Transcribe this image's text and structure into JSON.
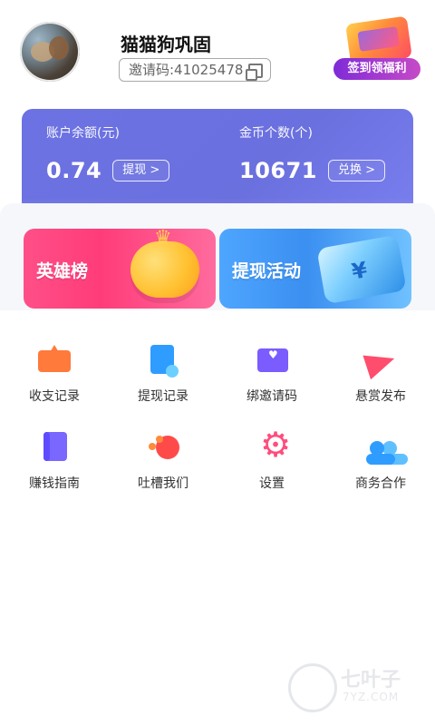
{
  "profile": {
    "username": "猫猫狗巩固",
    "invite_code": "邀请码:41025478"
  },
  "promo": {
    "checkin_label": "签到领福利"
  },
  "balance": {
    "account_title": "账户余额(元)",
    "account_value": "0.74",
    "withdraw_label": "提现 >",
    "coins_title": "金币个数(个)",
    "coins_value": "10671",
    "exchange_label": "兑换 >"
  },
  "banners": [
    {
      "title": "英雄榜"
    },
    {
      "title": "提现活动"
    }
  ],
  "menu": [
    {
      "label": "收支记录",
      "icon": "wallet-icon"
    },
    {
      "label": "提现记录",
      "icon": "withdraw-record-icon"
    },
    {
      "label": "绑邀请码",
      "icon": "invite-mail-icon"
    },
    {
      "label": "悬赏发布",
      "icon": "paper-plane-icon"
    },
    {
      "label": "赚钱指南",
      "icon": "guide-book-icon"
    },
    {
      "label": "吐槽我们",
      "icon": "feedback-icon"
    },
    {
      "label": "设置",
      "icon": "settings-gear-icon"
    },
    {
      "label": "商务合作",
      "icon": "business-users-icon"
    }
  ],
  "watermark": {
    "cn": "七叶子",
    "en": "7YZ.COM"
  },
  "colors": {
    "card": "#6c72e3",
    "pink_banner": "#ff4f88",
    "blue_banner": "#4ea6ff"
  }
}
